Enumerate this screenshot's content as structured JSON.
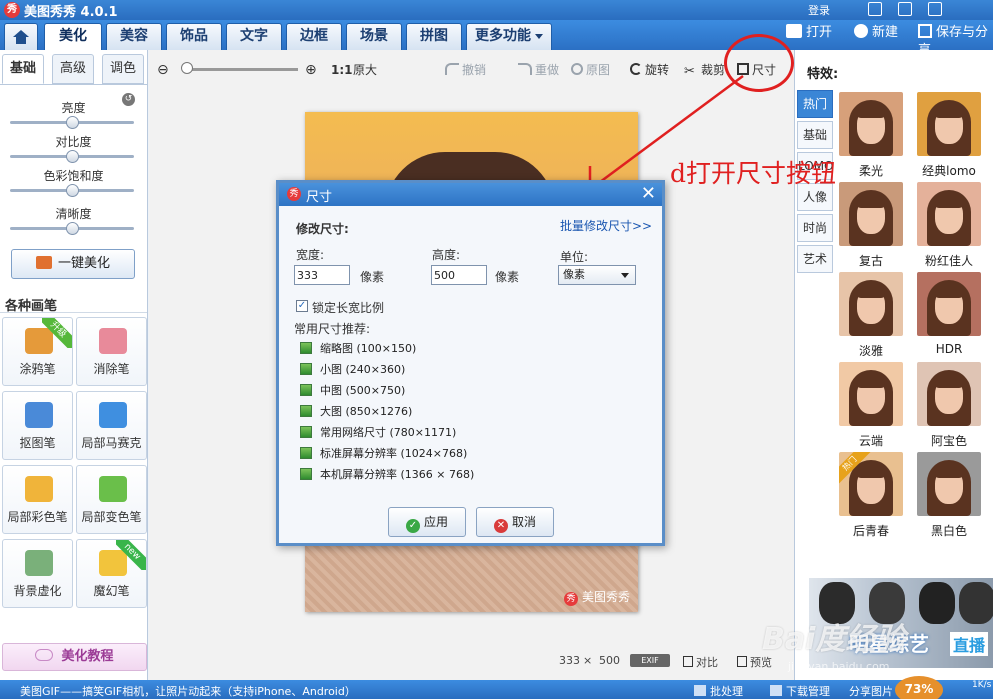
{
  "app": {
    "title": "美图秀秀 4.0.1",
    "login": "登录"
  },
  "main_tabs": [
    {
      "label": "美化"
    },
    {
      "label": "美容"
    },
    {
      "label": "饰品"
    },
    {
      "label": "文字"
    },
    {
      "label": "边框"
    },
    {
      "label": "场景"
    },
    {
      "label": "拼图"
    },
    {
      "label": "更多功能"
    }
  ],
  "top_actions": {
    "open": "打开",
    "new": "新建",
    "save_share": "保存与分享"
  },
  "left_panel": {
    "subtabs": [
      "基础",
      "高级",
      "调色"
    ],
    "adjustments": [
      {
        "label": "亮度",
        "level": 0.5
      },
      {
        "label": "对比度",
        "level": 0.5
      },
      {
        "label": "色彩饱和度",
        "level": 0.5
      },
      {
        "label": "清晰度",
        "level": 0.5
      }
    ],
    "one_key": "一键美化",
    "brush_title": "各种画笔",
    "tools": [
      {
        "label": "涂鸦笔",
        "badge": "升级",
        "color": "#e59a3a"
      },
      {
        "label": "消除笔",
        "badge": "",
        "color": "#e88a9a"
      },
      {
        "label": "抠图笔",
        "badge": "",
        "color": "#4a8ad8"
      },
      {
        "label": "局部马赛克",
        "badge": "",
        "color": "#3f8fe0"
      },
      {
        "label": "局部彩色笔",
        "badge": "",
        "color": "#f0b43a"
      },
      {
        "label": "局部变色笔",
        "badge": "",
        "color": "#6abf4a"
      },
      {
        "label": "背景虚化",
        "badge": "",
        "color": "#7ab07a"
      },
      {
        "label": "魔幻笔",
        "badge": "new",
        "color": "#f2c43c"
      }
    ],
    "tutorial": "美化教程"
  },
  "canvas_toolbar": {
    "ratio": "1:1",
    "original_size": "原大",
    "undo": "撤销",
    "redo": "重做",
    "original": "原图",
    "rotate": "旋转",
    "crop": "裁剪",
    "size": "尺寸"
  },
  "photo": {
    "watermark": "美图秀秀"
  },
  "canvas_bottom": {
    "width": "333",
    "times": "×",
    "height": "500",
    "exif": "EXIF",
    "compare": "对比",
    "preview": "预览"
  },
  "annotation": {
    "text": "d打开尺寸按钮",
    "color": "#e02020"
  },
  "dialog": {
    "title": "尺寸",
    "close": "✕",
    "modify_label": "修改尺寸:",
    "batch_link": "批量修改尺寸>>",
    "width_label": "宽度:",
    "width_value": "333",
    "width_unit": "像素",
    "height_label": "高度:",
    "height_value": "500",
    "height_unit": "像素",
    "unit_label": "单位:",
    "unit_value": "像素",
    "lock_label": "锁定长宽比例",
    "lock_checked": true,
    "presets_label": "常用尺寸推荐:",
    "presets": [
      "缩略图 (100×150)",
      "小图 (240×360)",
      "中图 (500×750)",
      "大图 (850×1276)",
      "常用网络尺寸 (780×1171)",
      "标准屏幕分辨率 (1024×768)",
      "本机屏幕分辨率 (1366 × 768)"
    ],
    "apply": "应用",
    "cancel": "取消"
  },
  "right_panel": {
    "title": "特效:",
    "tabs": [
      "热门",
      "基础",
      "LOMO",
      "人像",
      "时尚",
      "艺术"
    ],
    "effects": [
      {
        "label": "柔光",
        "tone": "#d7a07a",
        "hot": false
      },
      {
        "label": "经典lomo",
        "tone": "#e0a040",
        "hot": false
      },
      {
        "label": "复古",
        "tone": "#c99a7a",
        "hot": false
      },
      {
        "label": "粉红佳人",
        "tone": "#e4b19a",
        "hot": false
      },
      {
        "label": "淡雅",
        "tone": "#e7c4a8",
        "hot": false
      },
      {
        "label": "HDR",
        "tone": "#b57060",
        "hot": false
      },
      {
        "label": "云端",
        "tone": "#f1c9a5",
        "hot": false
      },
      {
        "label": "阿宝色",
        "tone": "#dfc4b4",
        "hot": false
      },
      {
        "label": "后青春",
        "tone": "#e9c090",
        "hot": true,
        "hot_text": "热门"
      },
      {
        "label": "黑白色",
        "tone": "#9a9a9a",
        "hot": false
      }
    ],
    "banner_text": "明星综艺",
    "banner_live": "直播"
  },
  "status_bar": {
    "tip": "美图GIF——搞笑GIF相机，让照片动起来（支持iPhone、Android）",
    "batch": "批处理",
    "download": "下载管理",
    "share_img": "分享图片",
    "percent": "73%",
    "speed": "1K/s"
  },
  "watermark": {
    "text": "Bai度经验",
    "sub": "jingyan.baidu.com"
  },
  "colors": {
    "accent": "#2a6dbf",
    "annotation_red": "#e02020",
    "ok_green": "#3aa845",
    "cancel_red": "#d93b3b"
  }
}
